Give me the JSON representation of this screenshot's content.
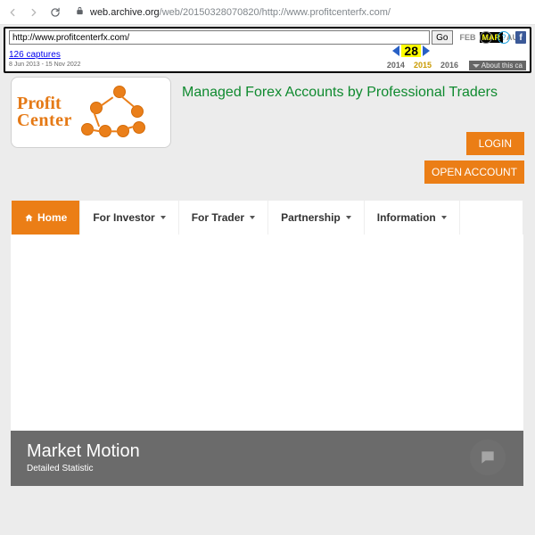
{
  "browser": {
    "url_host": "web.archive.org",
    "url_path": "/web/20150328070820/http://www.profitcenterfx.com/"
  },
  "wayback": {
    "input_url": "http://www.profitcenterfx.com/",
    "go": "Go",
    "captures_text": "126 captures",
    "date_range": "8 Jun 2013 - 15 Nov 2022",
    "month_prev": "FEB",
    "month_cur": "MAR",
    "month_next": "AUG",
    "day": "28",
    "year_prev": "2014",
    "year_cur": "2015",
    "year_next": "2016",
    "about": "About this ca"
  },
  "logo": {
    "line1": "Profit",
    "line2": "Center"
  },
  "tagline": "Managed Forex Accounts by Professional Traders",
  "auth": {
    "login": "LOGIN",
    "open": "OPEN ACCOUNT"
  },
  "nav": {
    "home": "Home",
    "investor": "For Investor",
    "trader": "For Trader",
    "partnership": "Partnership",
    "information": "Information"
  },
  "market": {
    "title": "Market Motion",
    "subtitle": "Detailed Statistic"
  }
}
